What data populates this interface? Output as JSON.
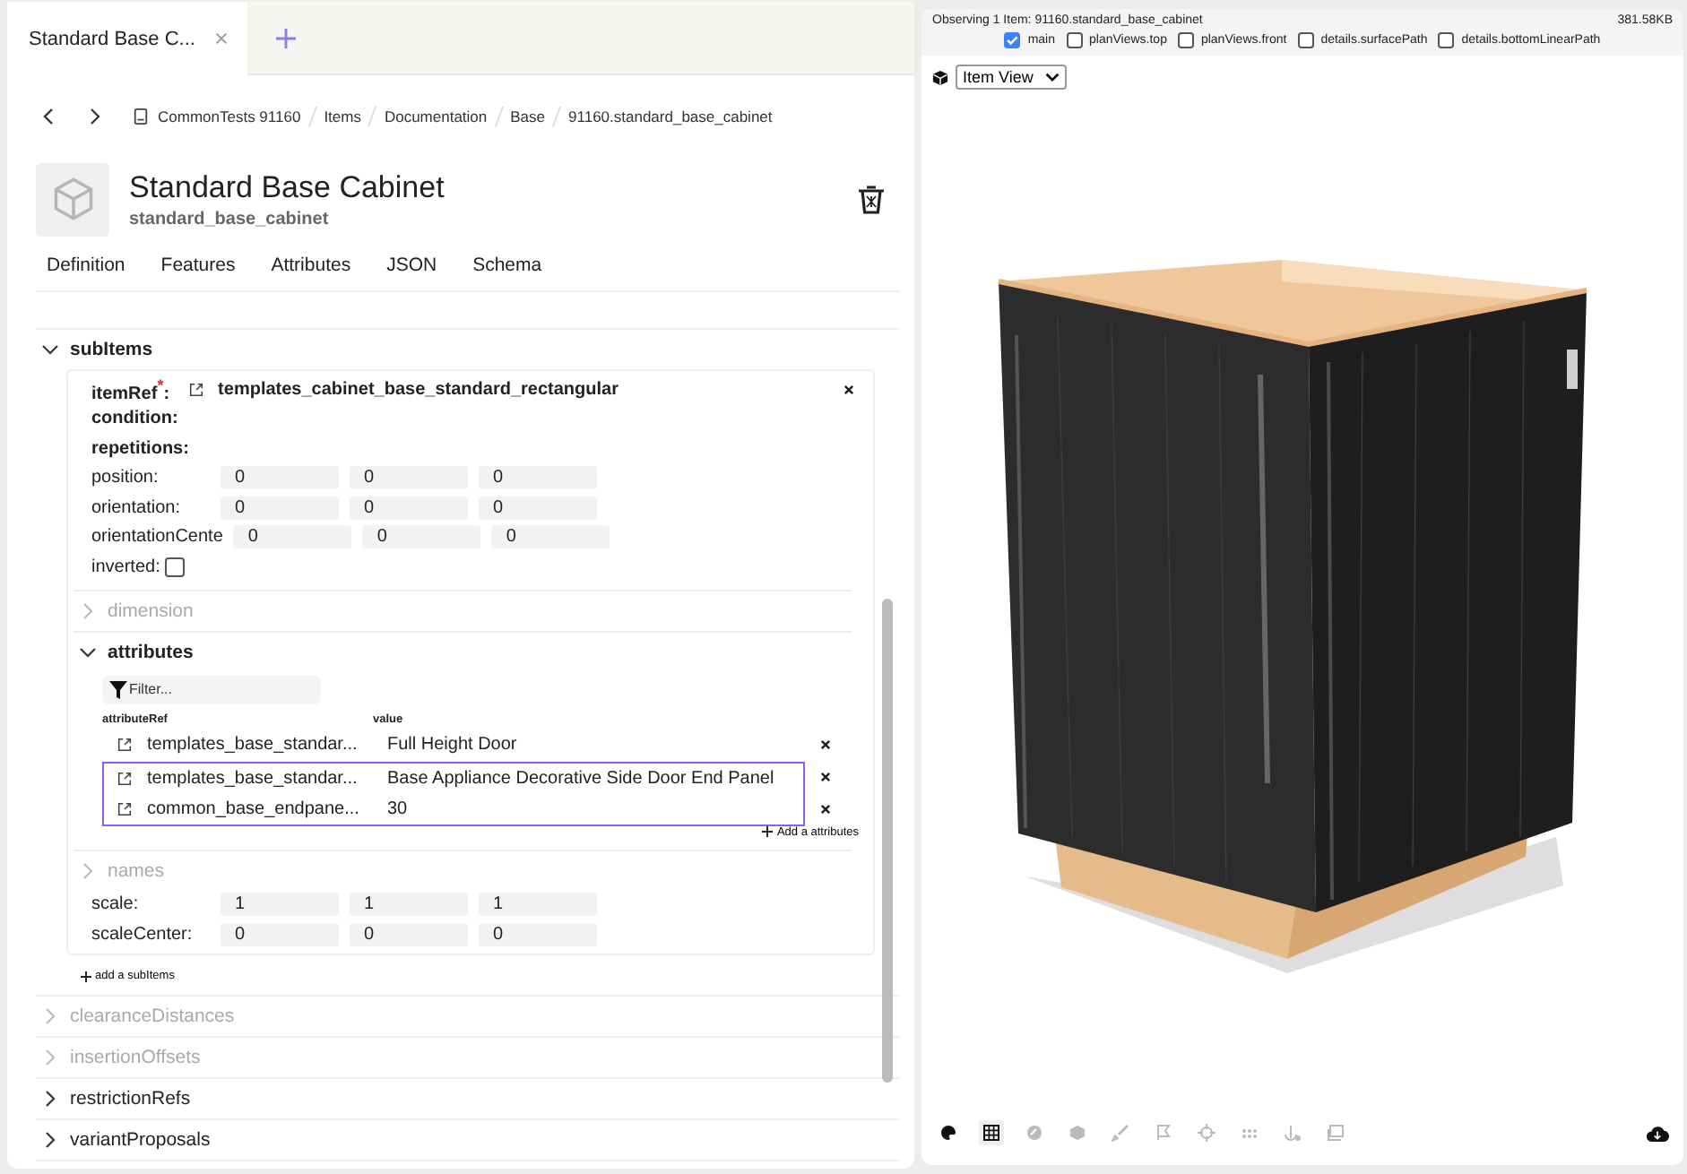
{
  "document_tabs": [
    {
      "label": "Standard Base C...",
      "selected": true
    }
  ],
  "breadcrumb": [
    "CommonTests 91160",
    "Items",
    "Documentation",
    "Base",
    "91160.standard_base_cabinet"
  ],
  "item": {
    "title": "Standard Base Cabinet",
    "subtitle": "standard_base_cabinet"
  },
  "nav_tabs": [
    "Definition",
    "Features",
    "Attributes",
    "JSON",
    "Schema"
  ],
  "sections": [
    {
      "label": "subItems",
      "expanded": true,
      "disabled": false,
      "add_label": "add a subItems",
      "subitem": {
        "item_ref": {
          "label": "itemRef$^{*}$:",
          "value": "templates_cabinet_base_standard_rectangular"
        },
        "labels": [
          "condition:",
          "repetitions:"
        ],
        "fields": [
          {
            "kind": "vector",
            "label": "position:",
            "values": [
              "0",
              "0",
              "0"
            ]
          },
          {
            "kind": "vector",
            "label": "orientation:",
            "values": [
              "0",
              "0",
              "0"
            ]
          },
          {
            "kind": "vector",
            "label": "orientationCente",
            "values": [
              "0",
              "0",
              "0"
            ]
          },
          {
            "kind": "checkbox",
            "label": "inverted:",
            "checked": false
          },
          {
            "kind": "section",
            "label": "dimension",
            "expanded": false,
            "disabled": true
          },
          {
            "kind": "section",
            "label": "attributes",
            "expanded": true,
            "disabled": false,
            "filter_placeholder": "Filter...",
            "columns": [
              "attributeRef",
              "value"
            ],
            "add_label": "Add a attributes",
            "rows": [
              {
                "ref": "templates_base_standar...",
                "value": "Full Height Door",
                "selected": false
              },
              {
                "ref": "templates_base_standar...",
                "value": "Base Appliance Decorative Side Door End Panel",
                "selected": true
              },
              {
                "ref": "common_base_endpane...",
                "value": "30",
                "selected": true
              }
            ]
          },
          {
            "kind": "section",
            "label": "names",
            "expanded": false,
            "disabled": true
          },
          {
            "kind": "vector",
            "label": "scale:",
            "values": [
              "1",
              "1",
              "1"
            ]
          },
          {
            "kind": "vector",
            "label": "scaleCenter:",
            "values": [
              "0",
              "0",
              "0"
            ]
          }
        ]
      }
    },
    {
      "label": "clearanceDistances",
      "expanded": false,
      "disabled": true
    },
    {
      "label": "insertionOffsets",
      "expanded": false,
      "disabled": true
    },
    {
      "label": "restrictionRefs",
      "expanded": false,
      "disabled": false
    },
    {
      "label": "variantProposals",
      "expanded": false,
      "disabled": false
    }
  ],
  "viewer": {
    "status": "Observing 1 Item: 91160.standard_base_cabinet",
    "size": "381.58KB",
    "layers": [
      {
        "label": "main",
        "checked": true
      },
      {
        "label": "planViews.top",
        "checked": false
      },
      {
        "label": "planViews.front",
        "checked": false
      },
      {
        "label": "details.surfacePath",
        "checked": false
      },
      {
        "label": "details.bottomLinearPath",
        "checked": false
      }
    ],
    "view": "Item View",
    "tools": [
      {
        "selected": false
      },
      {
        "selected": true
      },
      {
        "selected": false
      },
      {
        "selected": false
      },
      {
        "selected": false
      },
      {
        "selected": false
      },
      {
        "selected": false
      },
      {
        "selected": false
      },
      {
        "selected": false
      },
      {
        "selected": false
      }
    ]
  }
}
